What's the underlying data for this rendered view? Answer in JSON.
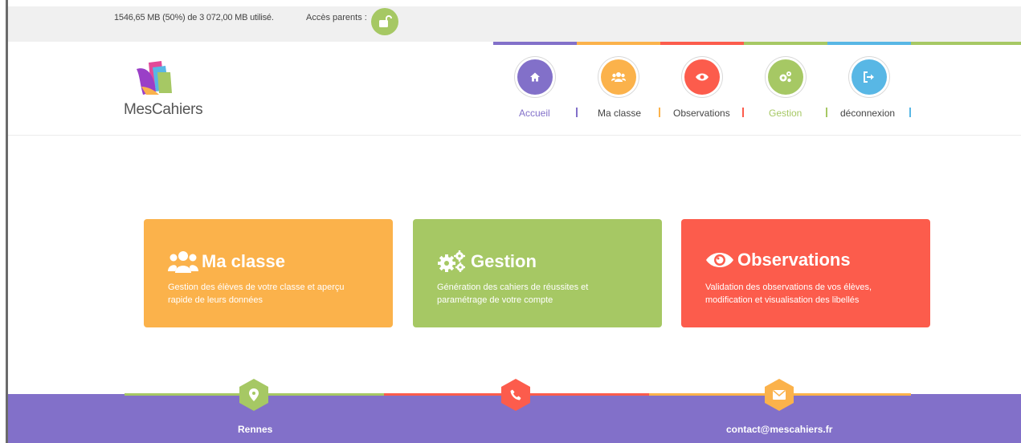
{
  "topbar": {
    "storage": "1546,65 MB (50%) de 3 072,00 MB utilisé.",
    "parents_label": "Accès parents :",
    "lock_icon": "unlock-icon"
  },
  "logo": {
    "text": "MesCahiers"
  },
  "nav": {
    "items": [
      {
        "label": "Accueil",
        "icon": "home-icon",
        "color": "#8270c9"
      },
      {
        "label": "Ma classe",
        "icon": "users-icon",
        "color": "#fbb24b"
      },
      {
        "label": "Observations",
        "icon": "eye-icon",
        "color": "#fc5c4c"
      },
      {
        "label": "Gestion",
        "icon": "gears-icon",
        "color": "#a6c864"
      },
      {
        "label": "déconnexion",
        "icon": "logout-icon",
        "color": "#58b7e5"
      }
    ],
    "active": "Gestion"
  },
  "cards": [
    {
      "title": "Ma classe",
      "icon": "users-icon",
      "color": "#fbb24b",
      "desc": "Gestion des élèves de votre classe et aperçu rapide de leurs données"
    },
    {
      "title": "Gestion",
      "icon": "gears-icon",
      "color": "#a6c864",
      "desc": "Génération des cahiers de réussites et paramétrage de votre compte"
    },
    {
      "title": "Observations",
      "icon": "eye-icon",
      "color": "#fc5c4c",
      "desc": "Validation des observations de vos élèves, modification et visualisation des libellés"
    }
  ],
  "footer": {
    "location": "Rennes",
    "email": "contact@mescahiers.fr",
    "icons": [
      "map-marker-icon",
      "phone-icon",
      "envelope-icon"
    ]
  }
}
